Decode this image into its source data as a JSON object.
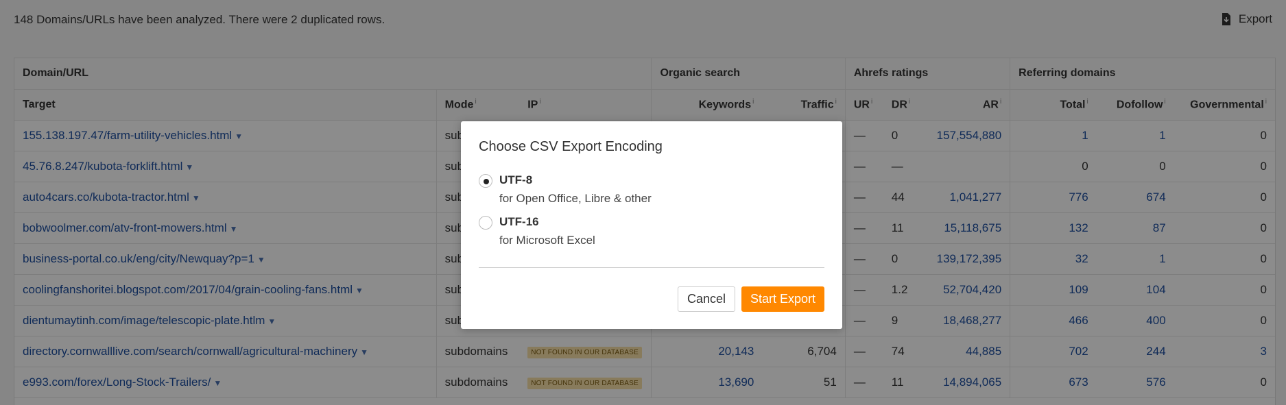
{
  "topbar": {
    "summary": "148 Domains/URLs have been analyzed. There were 2 duplicated rows.",
    "export_label": "Export",
    "export_icon": "download-icon"
  },
  "table": {
    "groups": [
      "Domain/URL",
      "Organic search",
      "Ahrefs ratings",
      "Referring domains"
    ],
    "columns": {
      "target": "Target",
      "mode": "Mode",
      "ip": "IP",
      "keywords": "Keywords",
      "traffic": "Traffic",
      "ur": "UR",
      "dr": "DR",
      "ar": "AR",
      "total": "Total",
      "dofollow": "Dofollow",
      "governmental": "Governmental"
    },
    "info_mark": "i",
    "caret": "▼",
    "rows": [
      {
        "target": "155.138.197.47/farm-utility-vehicles.html",
        "mode": "subd",
        "ip": "",
        "keywords": "",
        "traffic": "",
        "ur": "—",
        "dr": "0",
        "ar": "157,554,880",
        "total": "1",
        "dofollow": "1",
        "gov": "0"
      },
      {
        "target": "45.76.8.247/kubota-forklift.html",
        "mode": "sub",
        "ip": "",
        "keywords": "",
        "traffic": "",
        "ur": "—",
        "dr": "—",
        "ar": "",
        "total": "0",
        "dofollow": "0",
        "gov": "0"
      },
      {
        "target": "auto4cars.co/kubota-tractor.html",
        "mode": "sub",
        "ip": "",
        "keywords": "",
        "traffic": "",
        "ur": "—",
        "dr": "44",
        "ar": "1,041,277",
        "total": "776",
        "dofollow": "674",
        "gov": "0"
      },
      {
        "target": "bobwoolmer.com/atv-front-mowers.html",
        "mode": "sub",
        "ip": "",
        "keywords": "",
        "traffic": "",
        "ur": "—",
        "dr": "11",
        "ar": "15,118,675",
        "total": "132",
        "dofollow": "87",
        "gov": "0"
      },
      {
        "target": "business-portal.co.uk/eng/city/Newquay?p=1",
        "mode": "sub",
        "ip": "",
        "keywords": "",
        "traffic": "",
        "ur": "—",
        "dr": "0",
        "ar": "139,172,395",
        "total": "32",
        "dofollow": "1",
        "gov": "0"
      },
      {
        "target": "coolingfanshoritei.blogspot.com/2017/04/grain-cooling-fans.html",
        "mode": "sub",
        "ip": "",
        "keywords": "",
        "traffic": "",
        "ur": "—",
        "dr": "1.2",
        "ar": "52,704,420",
        "total": "109",
        "dofollow": "104",
        "gov": "0"
      },
      {
        "target": "dientumaytinh.com/image/telescopic-plate.htlm",
        "mode": "sub",
        "ip": "",
        "keywords": "",
        "traffic": "",
        "ur": "—",
        "dr": "9",
        "ar": "18,468,277",
        "total": "466",
        "dofollow": "400",
        "gov": "0"
      },
      {
        "target": "directory.cornwalllive.com/search/cornwall/agricultural-machinery",
        "mode": "subdomains",
        "ip": "NOT FOUND IN OUR DATABASE",
        "keywords": "20,143",
        "traffic": "6,704",
        "ur": "—",
        "dr": "74",
        "ar": "44,885",
        "total": "702",
        "dofollow": "244",
        "gov": "3"
      },
      {
        "target": "e993.com/forex/Long-Stock-Trailers/",
        "mode": "subdomains",
        "ip": "NOT FOUND IN OUR DATABASE",
        "keywords": "13,690",
        "traffic": "51",
        "ur": "—",
        "dr": "11",
        "ar": "14,894,065",
        "total": "673",
        "dofollow": "576",
        "gov": "0"
      }
    ]
  },
  "modal": {
    "title": "Choose CSV Export Encoding",
    "options": [
      {
        "name": "UTF-8",
        "desc": "for Open Office, Libre & other",
        "selected": true
      },
      {
        "name": "UTF-16",
        "desc": "for Microsoft Excel",
        "selected": false
      }
    ],
    "cancel_label": "Cancel",
    "start_label": "Start Export"
  },
  "colors": {
    "accent": "#ff8800",
    "link": "#1e4fa0",
    "badge_bg": "#f7e1a8"
  }
}
